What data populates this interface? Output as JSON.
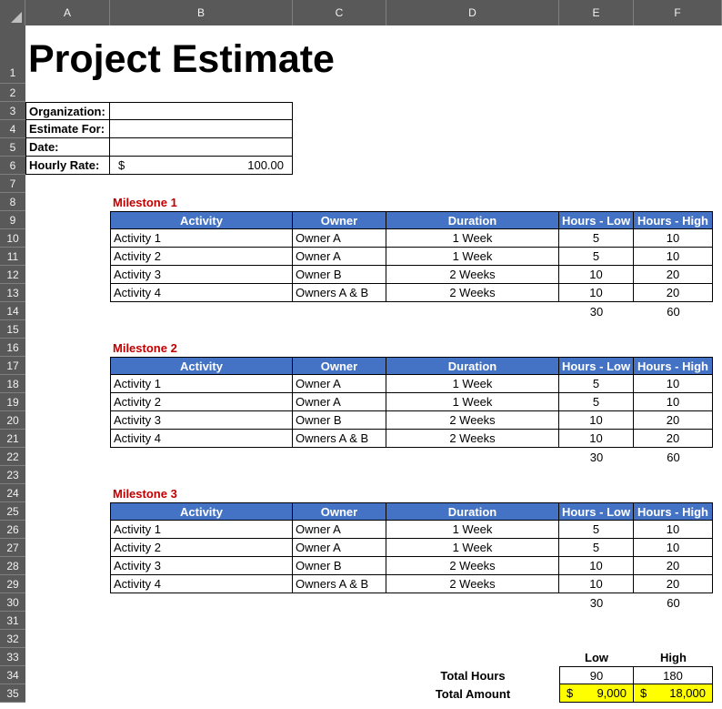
{
  "columns": [
    "A",
    "B",
    "C",
    "D",
    "E",
    "F"
  ],
  "rows": [
    "1",
    "2",
    "3",
    "4",
    "5",
    "6",
    "7",
    "8",
    "9",
    "10",
    "11",
    "12",
    "13",
    "14",
    "15",
    "16",
    "17",
    "18",
    "19",
    "20",
    "21",
    "22",
    "23",
    "24",
    "25",
    "26",
    "27",
    "28",
    "29",
    "30",
    "31",
    "32",
    "33",
    "34",
    "35"
  ],
  "title": "Project Estimate",
  "info": {
    "organization_label": "Organization:",
    "estimate_for_label": "Estimate For:",
    "date_label": "Date:",
    "hourly_rate_label": "Hourly Rate:",
    "hourly_rate_symbol": "$",
    "hourly_rate_value": "100.00"
  },
  "table_headers": [
    "Activity",
    "Owner",
    "Duration",
    "Hours - Low",
    "Hours - High"
  ],
  "milestones": [
    {
      "name": "Milestone 1",
      "rows": [
        [
          "Activity 1",
          "Owner A",
          "1 Week",
          "5",
          "10"
        ],
        [
          "Activity 2",
          "Owner A",
          "1 Week",
          "5",
          "10"
        ],
        [
          "Activity 3",
          "Owner B",
          "2 Weeks",
          "10",
          "20"
        ],
        [
          "Activity 4",
          "Owners A & B",
          "2 Weeks",
          "10",
          "20"
        ]
      ],
      "total_low": "30",
      "total_high": "60"
    },
    {
      "name": "Milestone 2",
      "rows": [
        [
          "Activity 1",
          "Owner A",
          "1 Week",
          "5",
          "10"
        ],
        [
          "Activity 2",
          "Owner A",
          "1 Week",
          "5",
          "10"
        ],
        [
          "Activity 3",
          "Owner B",
          "2 Weeks",
          "10",
          "20"
        ],
        [
          "Activity 4",
          "Owners A & B",
          "2 Weeks",
          "10",
          "20"
        ]
      ],
      "total_low": "30",
      "total_high": "60"
    },
    {
      "name": "Milestone 3",
      "rows": [
        [
          "Activity 1",
          "Owner A",
          "1 Week",
          "5",
          "10"
        ],
        [
          "Activity 2",
          "Owner A",
          "1 Week",
          "5",
          "10"
        ],
        [
          "Activity 3",
          "Owner B",
          "2 Weeks",
          "10",
          "20"
        ],
        [
          "Activity 4",
          "Owners A & B",
          "2 Weeks",
          "10",
          "20"
        ]
      ],
      "total_low": "30",
      "total_high": "60"
    }
  ],
  "summary": {
    "low_label": "Low",
    "high_label": "High",
    "total_hours_label": "Total Hours",
    "total_hours_low": "90",
    "total_hours_high": "180",
    "total_amount_label": "Total Amount",
    "currency_symbol": "$",
    "total_amount_low": "9,000",
    "total_amount_high": "18,000"
  },
  "colors": {
    "header_fill": "#4472c4",
    "milestone_text": "#c00000",
    "highlight_fill": "#ffff00",
    "grid_header": "#595959"
  }
}
